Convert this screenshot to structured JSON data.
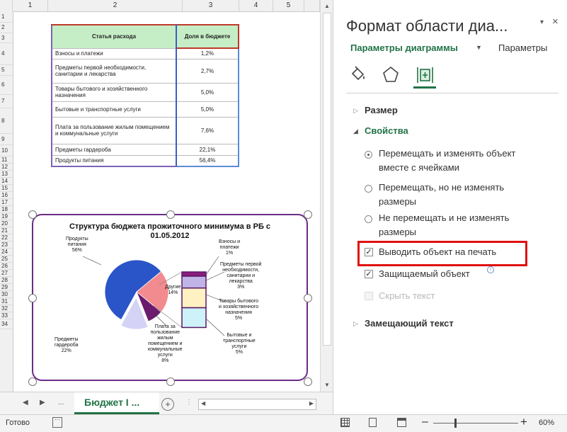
{
  "sheet": {
    "columns": [
      "1",
      "2",
      "3",
      "4",
      "5"
    ],
    "rows": [
      "1",
      "2",
      "3",
      "4",
      "5",
      "6",
      "7",
      "8",
      "9",
      "10",
      "11",
      "12",
      "13",
      "14",
      "15",
      "16",
      "17",
      "18",
      "19",
      "20",
      "21",
      "22",
      "23",
      "24",
      "25",
      "26",
      "27",
      "28",
      "29",
      "30",
      "31",
      "32",
      "33",
      "34"
    ]
  },
  "table": {
    "header_name": "Статья расхода",
    "header_value": "Доля в бюджете",
    "rows": [
      {
        "name": "Взносы и платежи",
        "value": "1,2%"
      },
      {
        "name": "Предметы первой необходимости, санитарии и лекарства",
        "value": "2,7%"
      },
      {
        "name": "Товары бытового и хозяйственного назначения",
        "value": "5,0%"
      },
      {
        "name": "Бытовые и транспортные услуги",
        "value": "5,0%"
      },
      {
        "name": "Плата за пользование жилым помещением и коммунальные услуги",
        "value": "7,6%"
      },
      {
        "name": "Предметы гардероба",
        "value": "22,1%"
      },
      {
        "name": "Продукты питания",
        "value": "56,4%"
      }
    ]
  },
  "chart_data": {
    "type": "pie",
    "title": "Структура бюджета прожиточного минимума в РБ с 01.05.2012",
    "slices": [
      {
        "label": "Продукты питания",
        "value": 56,
        "color": "#2a55c8"
      },
      {
        "label": "Предметы гардероба",
        "value": 22,
        "color": "#f28b8f"
      },
      {
        "label": "Плата за пользование жилым помещением и коммунальные услуги",
        "value": 8,
        "color": "#6a1b6e"
      },
      {
        "label": "Другие",
        "value": 14,
        "color": "#d4d2f5"
      }
    ],
    "bar_of_pie": [
      {
        "label": "Взносы и платежи",
        "value": 1,
        "color": "#8a1c7c"
      },
      {
        "label": "Предметы первой необходимости, санитарии и лекарства",
        "value": 3,
        "color": "#c0b4e6"
      },
      {
        "label": "Товары бытового и хозяйственного назначения",
        "value": 5,
        "color": "#fff2c2"
      },
      {
        "label": "Бытовые и транспортные услуги",
        "value": 5,
        "color": "#cdf3f8"
      }
    ],
    "labels": {
      "food": [
        "Продукты",
        "питания",
        "56%"
      ],
      "clothes": [
        "Предметы",
        "гардероба",
        "22%"
      ],
      "housing": [
        "Плата за",
        "пользование",
        "жилым",
        "помещением и",
        "коммунальные",
        "услуги",
        "8%"
      ],
      "other": [
        "Другие",
        "14%"
      ],
      "fees": [
        "Взносы и",
        "платежи",
        "1%"
      ],
      "essentials": [
        "Предметы первой",
        "необходимости,",
        "санитарии и",
        "лекарства",
        "3%"
      ],
      "household": [
        "Товары бытового",
        "и хозяйственного",
        "назначения",
        "5%"
      ],
      "services": [
        "Бытовые и",
        "транспортные",
        "услуги",
        "5%"
      ]
    }
  },
  "tabs": {
    "active": "Бюджет I ...",
    "ellipsis": "...",
    "add": "+"
  },
  "status": {
    "ready": "Готово",
    "zoom": "60%",
    "minus": "–",
    "plus": "+"
  },
  "pane": {
    "title": "Формат области диа...",
    "close": "×",
    "opts_arrow": "▾",
    "tab_chart_options": "Параметры диаграммы",
    "tab_chart_options_arrow": "▼",
    "tab_params": "Параметры",
    "size_section": "Размер",
    "props_section": "Свойства",
    "alt_text_section": "Замещающий текст",
    "size_arrow": "▷",
    "props_arrow": "◢",
    "alt_arrow": "▷",
    "radio1": "Перемещать и изменять объект вместе с ячейками",
    "radio2": "Перемещать, но не изменять размеры",
    "radio3": "Не перемещать и не изменять размеры",
    "print_object": "Выводить объект на печать",
    "locked": "Защищаемый объект",
    "hide_text": "Скрыть текст",
    "check_mark": "✓",
    "info": "i"
  },
  "colors": {
    "accent": "#217346",
    "highlight": "#e01010",
    "chart_border": "#6a2c87"
  }
}
